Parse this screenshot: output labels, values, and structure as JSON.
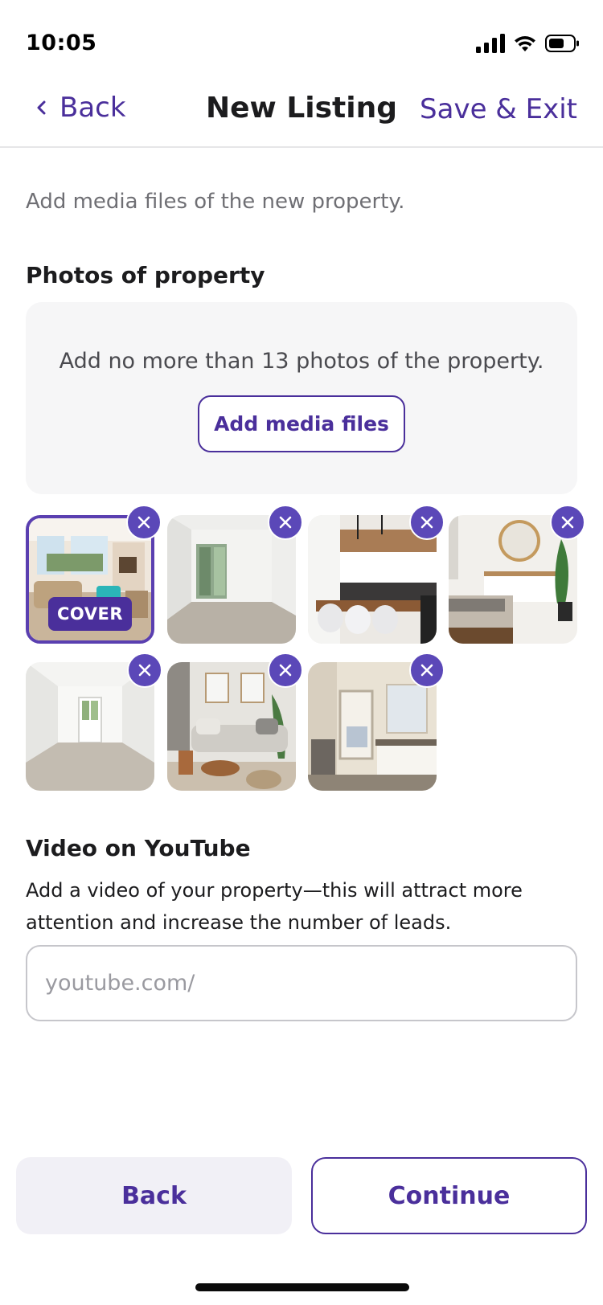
{
  "status_bar": {
    "time": "10:05",
    "icons": [
      "signal-icon",
      "wifi-icon",
      "battery-icon"
    ]
  },
  "nav": {
    "back_label": "Back",
    "title": "New Listing",
    "save_label": "Save & Exit"
  },
  "intro_text": "Add media files of the new property.",
  "photos": {
    "title": "Photos of property",
    "hint": "Add no more than 13 photos of the property.",
    "add_button": "Add media files",
    "cover_label": "COVER",
    "items": [
      {
        "scene": "living-room",
        "is_cover": true
      },
      {
        "scene": "empty-room-window",
        "is_cover": false
      },
      {
        "scene": "kitchen-dining",
        "is_cover": false
      },
      {
        "scene": "bedroom-mirror",
        "is_cover": false
      },
      {
        "scene": "empty-room-doors",
        "is_cover": false
      },
      {
        "scene": "lounge-sofa",
        "is_cover": false
      },
      {
        "scene": "bathroom-vanity",
        "is_cover": false
      }
    ]
  },
  "video": {
    "title": "Video on YouTube",
    "description": "Add a video of your property—this will attract more attention and increase the number of leads.",
    "placeholder": "youtube.com/",
    "value": ""
  },
  "footer": {
    "back_label": "Back",
    "continue_label": "Continue"
  },
  "colors": {
    "accent": "#4a2f9b",
    "remove_badge": "#5b48b8",
    "back_button_bg": "#f1f0f6",
    "dropzone_bg": "#f6f6f7"
  }
}
